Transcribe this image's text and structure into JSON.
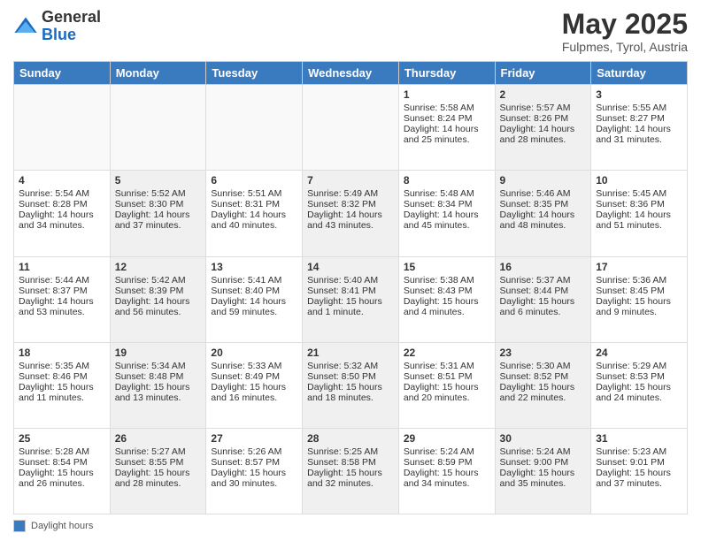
{
  "header": {
    "logo_general": "General",
    "logo_blue": "Blue",
    "month_title": "May 2025",
    "location": "Fulpmes, Tyrol, Austria"
  },
  "weekdays": [
    "Sunday",
    "Monday",
    "Tuesday",
    "Wednesday",
    "Thursday",
    "Friday",
    "Saturday"
  ],
  "footer": {
    "label": "Daylight hours"
  },
  "weeks": [
    [
      {
        "day": "",
        "content": "",
        "shaded": false
      },
      {
        "day": "",
        "content": "",
        "shaded": false
      },
      {
        "day": "",
        "content": "",
        "shaded": false
      },
      {
        "day": "",
        "content": "",
        "shaded": false
      },
      {
        "day": "1",
        "content": "Sunrise: 5:58 AM\nSunset: 8:24 PM\nDaylight: 14 hours and 25 minutes.",
        "shaded": false
      },
      {
        "day": "2",
        "content": "Sunrise: 5:57 AM\nSunset: 8:26 PM\nDaylight: 14 hours and 28 minutes.",
        "shaded": true
      },
      {
        "day": "3",
        "content": "Sunrise: 5:55 AM\nSunset: 8:27 PM\nDaylight: 14 hours and 31 minutes.",
        "shaded": false
      }
    ],
    [
      {
        "day": "4",
        "content": "Sunrise: 5:54 AM\nSunset: 8:28 PM\nDaylight: 14 hours and 34 minutes.",
        "shaded": false
      },
      {
        "day": "5",
        "content": "Sunrise: 5:52 AM\nSunset: 8:30 PM\nDaylight: 14 hours and 37 minutes.",
        "shaded": true
      },
      {
        "day": "6",
        "content": "Sunrise: 5:51 AM\nSunset: 8:31 PM\nDaylight: 14 hours and 40 minutes.",
        "shaded": false
      },
      {
        "day": "7",
        "content": "Sunrise: 5:49 AM\nSunset: 8:32 PM\nDaylight: 14 hours and 43 minutes.",
        "shaded": true
      },
      {
        "day": "8",
        "content": "Sunrise: 5:48 AM\nSunset: 8:34 PM\nDaylight: 14 hours and 45 minutes.",
        "shaded": false
      },
      {
        "day": "9",
        "content": "Sunrise: 5:46 AM\nSunset: 8:35 PM\nDaylight: 14 hours and 48 minutes.",
        "shaded": true
      },
      {
        "day": "10",
        "content": "Sunrise: 5:45 AM\nSunset: 8:36 PM\nDaylight: 14 hours and 51 minutes.",
        "shaded": false
      }
    ],
    [
      {
        "day": "11",
        "content": "Sunrise: 5:44 AM\nSunset: 8:37 PM\nDaylight: 14 hours and 53 minutes.",
        "shaded": false
      },
      {
        "day": "12",
        "content": "Sunrise: 5:42 AM\nSunset: 8:39 PM\nDaylight: 14 hours and 56 minutes.",
        "shaded": true
      },
      {
        "day": "13",
        "content": "Sunrise: 5:41 AM\nSunset: 8:40 PM\nDaylight: 14 hours and 59 minutes.",
        "shaded": false
      },
      {
        "day": "14",
        "content": "Sunrise: 5:40 AM\nSunset: 8:41 PM\nDaylight: 15 hours and 1 minute.",
        "shaded": true
      },
      {
        "day": "15",
        "content": "Sunrise: 5:38 AM\nSunset: 8:43 PM\nDaylight: 15 hours and 4 minutes.",
        "shaded": false
      },
      {
        "day": "16",
        "content": "Sunrise: 5:37 AM\nSunset: 8:44 PM\nDaylight: 15 hours and 6 minutes.",
        "shaded": true
      },
      {
        "day": "17",
        "content": "Sunrise: 5:36 AM\nSunset: 8:45 PM\nDaylight: 15 hours and 9 minutes.",
        "shaded": false
      }
    ],
    [
      {
        "day": "18",
        "content": "Sunrise: 5:35 AM\nSunset: 8:46 PM\nDaylight: 15 hours and 11 minutes.",
        "shaded": false
      },
      {
        "day": "19",
        "content": "Sunrise: 5:34 AM\nSunset: 8:48 PM\nDaylight: 15 hours and 13 minutes.",
        "shaded": true
      },
      {
        "day": "20",
        "content": "Sunrise: 5:33 AM\nSunset: 8:49 PM\nDaylight: 15 hours and 16 minutes.",
        "shaded": false
      },
      {
        "day": "21",
        "content": "Sunrise: 5:32 AM\nSunset: 8:50 PM\nDaylight: 15 hours and 18 minutes.",
        "shaded": true
      },
      {
        "day": "22",
        "content": "Sunrise: 5:31 AM\nSunset: 8:51 PM\nDaylight: 15 hours and 20 minutes.",
        "shaded": false
      },
      {
        "day": "23",
        "content": "Sunrise: 5:30 AM\nSunset: 8:52 PM\nDaylight: 15 hours and 22 minutes.",
        "shaded": true
      },
      {
        "day": "24",
        "content": "Sunrise: 5:29 AM\nSunset: 8:53 PM\nDaylight: 15 hours and 24 minutes.",
        "shaded": false
      }
    ],
    [
      {
        "day": "25",
        "content": "Sunrise: 5:28 AM\nSunset: 8:54 PM\nDaylight: 15 hours and 26 minutes.",
        "shaded": false
      },
      {
        "day": "26",
        "content": "Sunrise: 5:27 AM\nSunset: 8:55 PM\nDaylight: 15 hours and 28 minutes.",
        "shaded": true
      },
      {
        "day": "27",
        "content": "Sunrise: 5:26 AM\nSunset: 8:57 PM\nDaylight: 15 hours and 30 minutes.",
        "shaded": false
      },
      {
        "day": "28",
        "content": "Sunrise: 5:25 AM\nSunset: 8:58 PM\nDaylight: 15 hours and 32 minutes.",
        "shaded": true
      },
      {
        "day": "29",
        "content": "Sunrise: 5:24 AM\nSunset: 8:59 PM\nDaylight: 15 hours and 34 minutes.",
        "shaded": false
      },
      {
        "day": "30",
        "content": "Sunrise: 5:24 AM\nSunset: 9:00 PM\nDaylight: 15 hours and 35 minutes.",
        "shaded": true
      },
      {
        "day": "31",
        "content": "Sunrise: 5:23 AM\nSunset: 9:01 PM\nDaylight: 15 hours and 37 minutes.",
        "shaded": false
      }
    ]
  ]
}
